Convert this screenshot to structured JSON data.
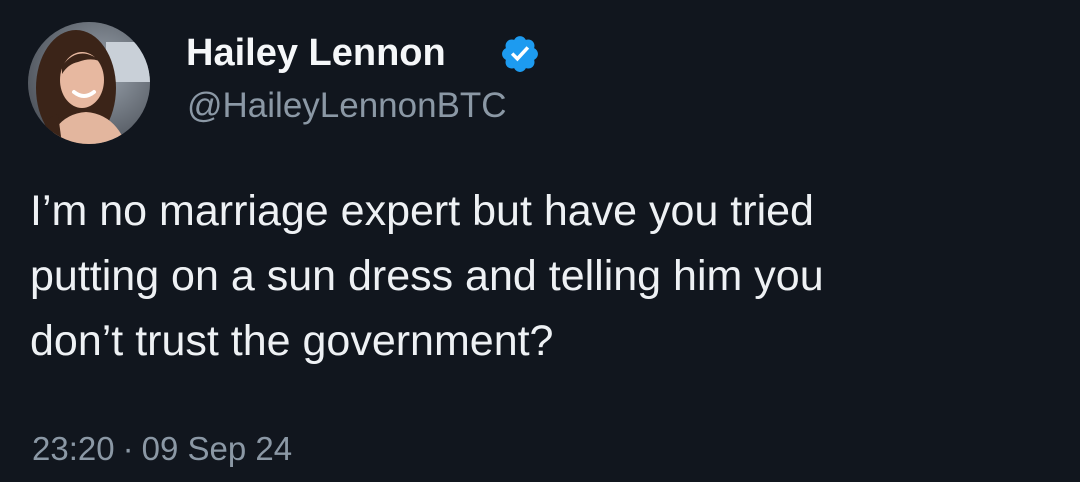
{
  "author": {
    "display_name": "Hailey Lennon",
    "handle": "@HaileyLennonBTC",
    "verified_icon": "verified-badge-icon",
    "avatar": "profile-photo"
  },
  "tweet": {
    "lines": [
      "I’m no marriage expert but have you tried",
      "putting on a sun dress and telling him you",
      "don’t trust the government?"
    ]
  },
  "meta": {
    "time": "23:20",
    "separator": "·",
    "date": "09 Sep 24"
  },
  "colors": {
    "background": "#11161e",
    "text": "#eef1f4",
    "secondary_text": "#8b98a5",
    "verified_blue": "#1d9bf0"
  }
}
